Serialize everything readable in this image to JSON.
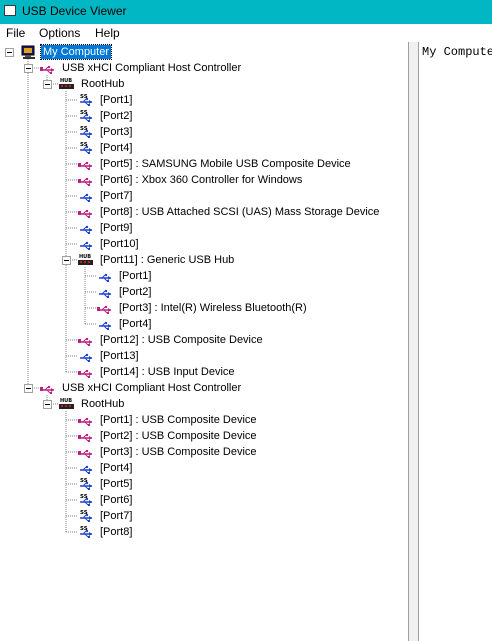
{
  "window": {
    "title": "USB Device Viewer"
  },
  "menu": {
    "items": [
      "File",
      "Options",
      "Help"
    ]
  },
  "detail": {
    "text": "My Computer"
  },
  "tree": [
    {
      "level": 0,
      "icon": "computer-icon",
      "label": "My Computer",
      "expander": true,
      "selected": true
    },
    {
      "level": 1,
      "icon": "usb-device-icon",
      "label": "USB xHCI Compliant Host Controller",
      "expander": true
    },
    {
      "level": 2,
      "icon": "hub-icon",
      "label": "RootHub",
      "expander": true
    },
    {
      "level": 3,
      "icon": "ss-port-icon",
      "label": "[Port1]"
    },
    {
      "level": 3,
      "icon": "ss-port-icon",
      "label": "[Port2]"
    },
    {
      "level": 3,
      "icon": "ss-port-icon",
      "label": "[Port3]"
    },
    {
      "level": 3,
      "icon": "ss-port-icon",
      "label": "[Port4]"
    },
    {
      "level": 3,
      "icon": "usb-device-icon",
      "label": "[Port5]  :  SAMSUNG Mobile USB Composite Device"
    },
    {
      "level": 3,
      "icon": "usb-device-icon",
      "label": "[Port6]  :  Xbox 360 Controller for Windows"
    },
    {
      "level": 3,
      "icon": "usb-port-icon",
      "label": "[Port7]"
    },
    {
      "level": 3,
      "icon": "usb-device-icon",
      "label": "[Port8]  :  USB Attached SCSI (UAS) Mass Storage Device"
    },
    {
      "level": 3,
      "icon": "usb-port-icon",
      "label": "[Port9]"
    },
    {
      "level": 3,
      "icon": "usb-port-icon",
      "label": "[Port10]"
    },
    {
      "level": 3,
      "icon": "hub-icon",
      "label": "[Port11]  :  Generic USB Hub",
      "expander": true
    },
    {
      "level": 4,
      "icon": "usb-port-icon",
      "label": "[Port1]"
    },
    {
      "level": 4,
      "icon": "usb-port-icon",
      "label": "[Port2]"
    },
    {
      "level": 4,
      "icon": "usb-device-icon",
      "label": "[Port3]  :  Intel(R) Wireless Bluetooth(R)"
    },
    {
      "level": 4,
      "icon": "usb-port-icon",
      "label": "[Port4]"
    },
    {
      "level": 3,
      "icon": "usb-device-icon",
      "label": "[Port12]  :  USB Composite Device"
    },
    {
      "level": 3,
      "icon": "usb-port-icon",
      "label": "[Port13]"
    },
    {
      "level": 3,
      "icon": "usb-device-icon",
      "label": "[Port14]  :  USB Input Device"
    },
    {
      "level": 1,
      "icon": "usb-device-icon",
      "label": "USB xHCI Compliant Host Controller",
      "expander": true
    },
    {
      "level": 2,
      "icon": "hub-icon",
      "label": "RootHub",
      "expander": true
    },
    {
      "level": 3,
      "icon": "usb-device-icon",
      "label": "[Port1]  :  USB Composite Device"
    },
    {
      "level": 3,
      "icon": "usb-device-icon",
      "label": "[Port2]  :  USB Composite Device"
    },
    {
      "level": 3,
      "icon": "usb-device-icon",
      "label": "[Port3]  :  USB Composite Device"
    },
    {
      "level": 3,
      "icon": "usb-port-icon",
      "label": "[Port4]"
    },
    {
      "level": 3,
      "icon": "ss-port-icon",
      "label": "[Port5]"
    },
    {
      "level": 3,
      "icon": "ss-port-icon",
      "label": "[Port6]"
    },
    {
      "level": 3,
      "icon": "ss-port-icon",
      "label": "[Port7]"
    },
    {
      "level": 3,
      "icon": "ss-port-icon",
      "label": "[Port8]"
    }
  ],
  "colors": {
    "titlebar": "#00b7c3",
    "selection": "#0078d7",
    "usb_port": "#2040d0",
    "usb_device": "#c02080"
  }
}
